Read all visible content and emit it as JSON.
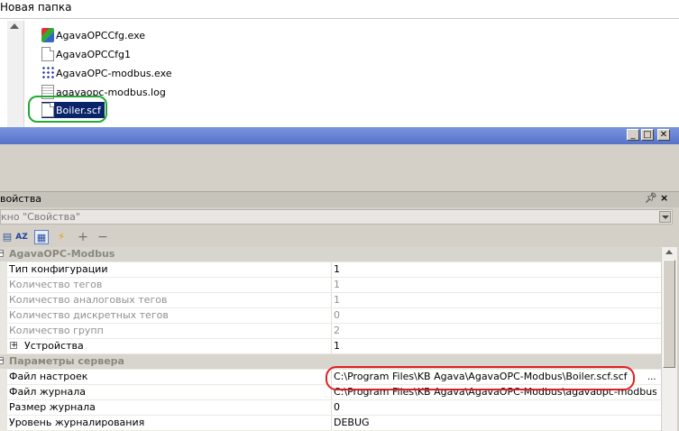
{
  "explorer": {
    "folder_title": "Новая папка",
    "files": [
      {
        "name": "AgavaOPCCfg.exe",
        "icon": "exe-icon"
      },
      {
        "name": "AgavaOPCCfg1",
        "icon": "document-icon"
      },
      {
        "name": "AgavaOPC-modbus.exe",
        "icon": "modbus-exe-icon"
      },
      {
        "name": "agavaopc-modbus.log",
        "icon": "log-file-icon"
      },
      {
        "name": "Boiler.scf",
        "icon": "document-icon",
        "selected": true
      }
    ]
  },
  "window_buttons": {
    "minimize": "_",
    "maximize": "□",
    "close": "✕"
  },
  "properties": {
    "panel_title": "войства",
    "object_combo": "кно \"Свойства\"",
    "toolbar": {
      "add": "+",
      "remove": "−"
    },
    "categories": [
      {
        "title": "AgavaOPC-Modbus",
        "rows": [
          {
            "name": "Тип конфигурации",
            "value": "1"
          },
          {
            "name": "Количество тегов",
            "value": "1"
          },
          {
            "name": "Количество аналоговых тегов",
            "value": "1"
          },
          {
            "name": "Количество дискретных тегов",
            "value": "0"
          },
          {
            "name": "Количество групп",
            "value": "2"
          },
          {
            "name": "Устройства",
            "value": "1"
          }
        ]
      },
      {
        "title": "Параметры сервера",
        "rows": [
          {
            "name": "Файл настроек",
            "value": "C:\\Program Files\\KB Agava\\AgavaOPC-Modbus\\Boiler.scf.scf"
          },
          {
            "name": "Файл журнала",
            "value": "C:\\Program Files\\KB Agava\\AgavaOPC-Modbus\\agavaopc-modbus.l..."
          },
          {
            "name": "Размер журнала",
            "value": "0"
          },
          {
            "name": "Уровень журналирования",
            "value": "DEBUG"
          }
        ]
      }
    ]
  },
  "colors": {
    "annotation_green": "#22aa33",
    "annotation_red": "#e02020",
    "selection": "#0a246a"
  }
}
